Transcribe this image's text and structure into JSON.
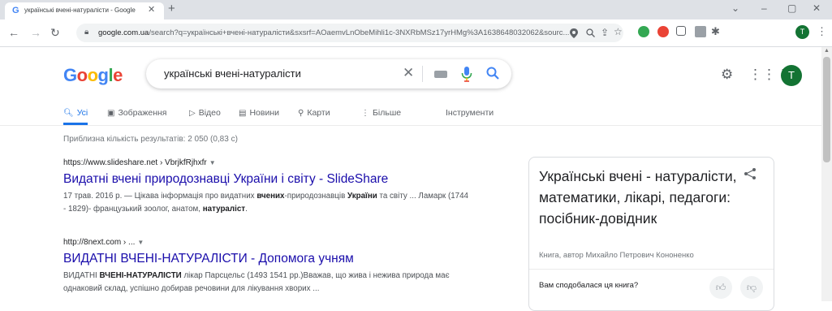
{
  "browser": {
    "tab_title": "українські вчені-натуралісти - Google",
    "tab_favicon": "G",
    "new_tab": "+",
    "tab_close": "✕",
    "url_host": "google.com.ua",
    "url_path": "/search?q=українські+вчені-натуралісти&sxsrf=AOaemvLnObeMihli1c-3NXRbMSz17yrHMg%3A1638648032062&sourc...",
    "window_controls": {
      "collapse": "⌄",
      "minimize": "–",
      "maximize": "▢",
      "close": "✕"
    },
    "profile_initial": "T"
  },
  "google": {
    "logo": {
      "letters": [
        "G",
        "o",
        "o",
        "g",
        "l",
        "e"
      ],
      "colors": [
        "#4285f4",
        "#ea4335",
        "#fbbc05",
        "#4285f4",
        "#34a853",
        "#ea4335"
      ]
    },
    "query": "українські вчені-натуралісти",
    "account_initial": "T"
  },
  "tabs": [
    {
      "label": "Усі",
      "icon": "search-icon"
    },
    {
      "label": "Зображення",
      "icon": "image-icon"
    },
    {
      "label": "Відео",
      "icon": "video-icon"
    },
    {
      "label": "Новини",
      "icon": "news-icon"
    },
    {
      "label": "Карти",
      "icon": "map-pin-icon"
    },
    {
      "label": "Більше",
      "icon": "more-vert-icon"
    }
  ],
  "tools_label": "Інструменти",
  "stats": "Приблизна кількість результатів: 2 050 (0,83 с)",
  "results": [
    {
      "cite": "https://www.slideshare.net › VbrjkfRjhxfr",
      "title": "Видатні вчені природознавці України і світу - SlideShare",
      "snippet_parts": [
        [
          "17 трав. 2016 р. — Цікава інформація про видатних ",
          false
        ],
        [
          "вчених",
          true
        ],
        [
          "-природознавців ",
          false
        ],
        [
          "України",
          true
        ],
        [
          " та світу ... Ламарк (1744 - 1829)- французький зоолог, анатом, ",
          false
        ],
        [
          "натураліст",
          true
        ],
        [
          ".",
          false
        ]
      ]
    },
    {
      "cite": "http://8next.com › ...",
      "title": "ВИДАТНІ ВЧЕНІ-НАТУРАЛІСТИ - Допомога учням",
      "snippet_parts": [
        [
          "ВИДАТНІ ",
          false
        ],
        [
          "ВЧЕНІ-НАТУРАЛІСТИ",
          true
        ],
        [
          " лікар Парсцельс (1493 1541 рр.)Вважав, що жива і нежива природа має однаковий склад, успішно добирав речовини для лікування хворих ...",
          false
        ]
      ]
    }
  ],
  "knowledge_panel": {
    "title": "Українські вчені - натуралісти, математики, лікарі, педагоги: посібник-довідник",
    "subtitle": "Книга, автор Михайло Петрович Кононенко",
    "question": "Вам сподобалася ця книга?"
  }
}
